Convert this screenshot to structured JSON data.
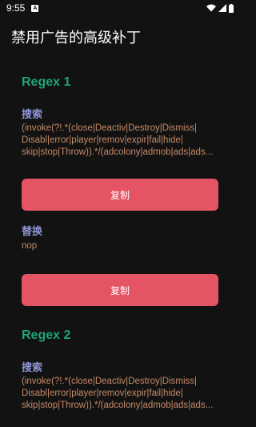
{
  "status_bar": {
    "time": "9:55",
    "notification_letter": "A"
  },
  "app_bar": {
    "title": "禁用广告的高级补丁"
  },
  "regex_blocks": [
    {
      "title": "Regex 1",
      "search_label": "搜索",
      "search_lines": [
        "(invoke(?!.*(close|Deactiv|Destroy|Dismiss|",
        "Disabl|error|player|remov|expir|fail|hide|",
        "skip|stop|Throw)).*/(adcolony|admob|ads|ads..."
      ],
      "copy_label_1": "复制",
      "replace_label": "替换",
      "replace_value": "nop",
      "copy_label_2": "复制"
    },
    {
      "title": "Regex 2",
      "search_label": "搜索",
      "search_lines": [
        "(invoke(?!.*(close|Deactiv|Destroy|Dismiss|",
        "Disabl|error|player|remov|expir|fail|hide|",
        "skip|stop|Throw)).*/(adcolony|admob|ads|ads..."
      ]
    }
  ],
  "colors": {
    "background": "#121212",
    "title_green": "#1fa37b",
    "label_purple": "#8f95d6",
    "value_orange": "#c58a68",
    "button_red": "#e45464"
  },
  "icons": [
    "notification-icon",
    "wifi-icon",
    "signal-icon",
    "battery-icon"
  ]
}
